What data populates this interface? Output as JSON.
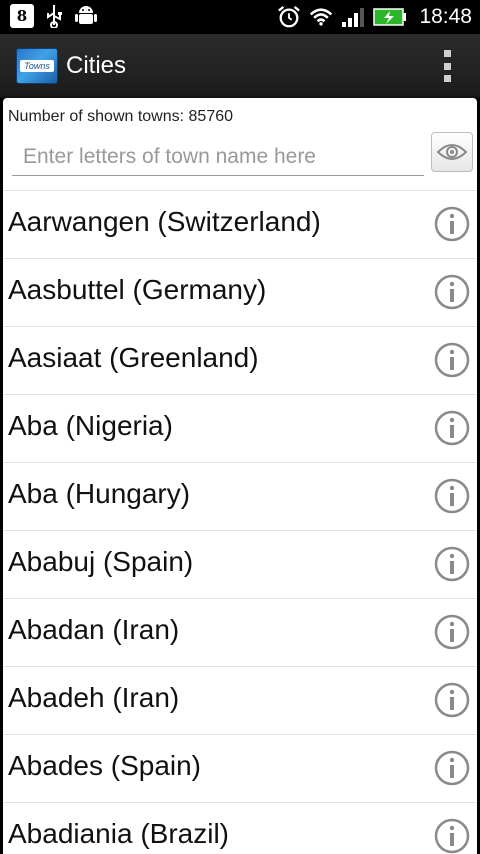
{
  "status_bar": {
    "time": "18:48",
    "left_icons": [
      "google-plus-icon",
      "usb-icon",
      "android-debug-icon"
    ],
    "right_icons": [
      "alarm-icon",
      "wifi-icon",
      "signal-icon",
      "battery-charging-icon"
    ],
    "gplus_text": "8"
  },
  "action_bar": {
    "app_icon_text": "Towns",
    "title": "Cities",
    "menu_icon": "overflow-menu-icon"
  },
  "header": {
    "count_text": "Number of shown towns: 85760",
    "search_placeholder": "Enter letters of town name here",
    "search_value": "",
    "eye_icon": "eye-icon"
  },
  "towns": [
    {
      "label": "Aarwangen (Switzerland)"
    },
    {
      "label": "Aasbuttel (Germany)"
    },
    {
      "label": "Aasiaat (Greenland)"
    },
    {
      "label": "Aba (Nigeria)"
    },
    {
      "label": "Aba (Hungary)"
    },
    {
      "label": "Ababuj (Spain)"
    },
    {
      "label": "Abadan (Iran)"
    },
    {
      "label": "Abadeh (Iran)"
    },
    {
      "label": "Abades (Spain)"
    },
    {
      "label": "Abadiania (Brazil)"
    }
  ],
  "colors": {
    "status_bar_bg": "#000000",
    "action_bar_bg": "#222222",
    "list_bg": "#ffffff",
    "info_icon": "#8a8a8a"
  }
}
